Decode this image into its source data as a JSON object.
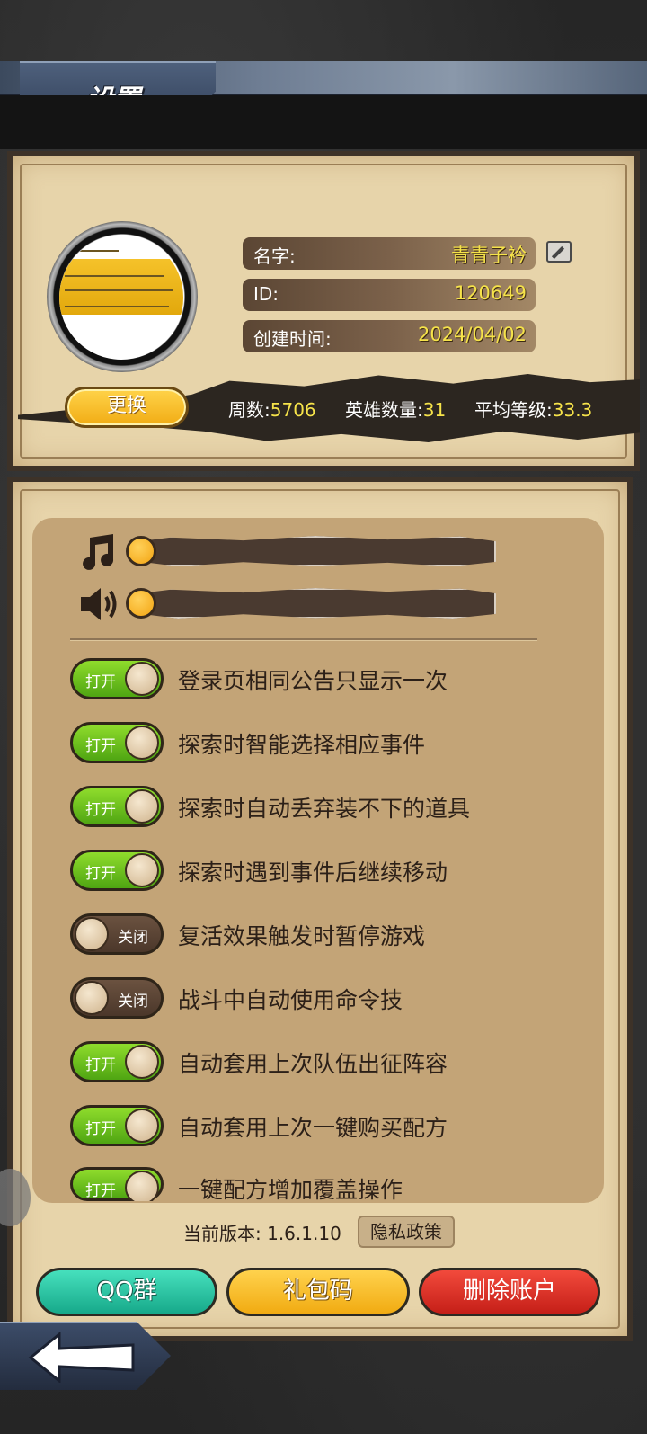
{
  "header": {
    "title": "设置"
  },
  "profile": {
    "name_label": "名字:",
    "name_value": "青青子衿",
    "id_label": "ID:",
    "id_value": "120649",
    "created_label": "创建时间:",
    "created_value": "2024/04/02",
    "change_button": "更换",
    "stats": [
      {
        "label": "周数:",
        "value": "5706"
      },
      {
        "label": "英雄数量:",
        "value": "31"
      },
      {
        "label": "平均等级:",
        "value": "33.3"
      }
    ]
  },
  "audio": {
    "music_level": 0.0,
    "sound_level": 0.0
  },
  "toggles": [
    {
      "state": "on",
      "state_label": "打开",
      "text": "登录页相同公告只显示一次"
    },
    {
      "state": "on",
      "state_label": "打开",
      "text": "探索时智能选择相应事件"
    },
    {
      "state": "on",
      "state_label": "打开",
      "text": "探索时自动丢弃装不下的道具"
    },
    {
      "state": "on",
      "state_label": "打开",
      "text": "探索时遇到事件后继续移动"
    },
    {
      "state": "off",
      "state_label": "关闭",
      "text": "复活效果触发时暂停游戏"
    },
    {
      "state": "off",
      "state_label": "关闭",
      "text": "战斗中自动使用命令技"
    },
    {
      "state": "on",
      "state_label": "打开",
      "text": "自动套用上次队伍出征阵容"
    },
    {
      "state": "on",
      "state_label": "打开",
      "text": "自动套用上次一键购买配方"
    },
    {
      "state": "on",
      "state_label": "打开",
      "text": "一键配方增加覆盖操作"
    }
  ],
  "footer": {
    "version": "当前版本: 1.6.1.10",
    "privacy_button": "隐私政策",
    "qq_button": "QQ群",
    "gift_button": "礼包码",
    "delete_button": "删除账户"
  },
  "colors": {
    "toggle_on": "#6ec41e",
    "toggle_off": "#5b4333",
    "highlight_text": "#f6e34a"
  }
}
